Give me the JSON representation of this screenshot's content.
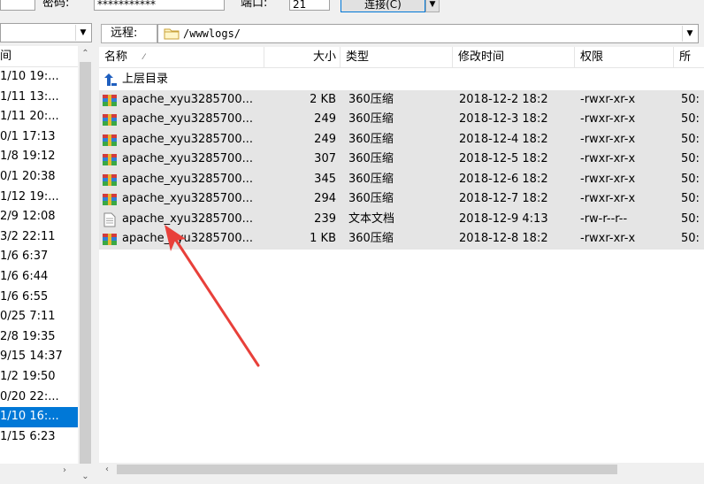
{
  "toolbar": {
    "password_label": "密码:",
    "password_value": "***********",
    "port_label": "端口:",
    "port_value": "21",
    "connect_button": "连接(C)"
  },
  "local": {
    "column_header": "间",
    "rows": [
      "1/10 19:...",
      "1/11 13:...",
      "1/11 20:...",
      "0/1 17:13",
      "1/8 19:12",
      "0/1 20:38",
      "1/12 19:...",
      "2/9 12:08",
      "3/2 22:11",
      "1/6 6:37",
      "1/6 6:44",
      "1/6 6:55",
      "0/25 7:11",
      "2/8 19:35",
      "9/15 14:37",
      "1/2 19:50",
      "0/20 22:...",
      "1/10 16:...",
      "1/15 6:23"
    ],
    "selected_index": 17
  },
  "remote": {
    "label": "远程:",
    "path": "/wwwlogs/",
    "columns": {
      "name": "名称",
      "size": "大小",
      "type": "类型",
      "modified": "修改时间",
      "permissions": "权限",
      "owner": "所"
    },
    "parent_dir": "上层目录",
    "files": [
      {
        "name": "apache_xyu3285700...",
        "size": "2 KB",
        "type": "360压缩",
        "modified": "2018-12-2 18:2",
        "permissions": "-rwxr-xr-x",
        "owner": "50:",
        "icon": "archive-icon"
      },
      {
        "name": "apache_xyu3285700...",
        "size": "249",
        "type": "360压缩",
        "modified": "2018-12-3 18:2",
        "permissions": "-rwxr-xr-x",
        "owner": "50:",
        "icon": "archive-icon"
      },
      {
        "name": "apache_xyu3285700...",
        "size": "249",
        "type": "360压缩",
        "modified": "2018-12-4 18:2",
        "permissions": "-rwxr-xr-x",
        "owner": "50:",
        "icon": "archive-icon"
      },
      {
        "name": "apache_xyu3285700...",
        "size": "307",
        "type": "360压缩",
        "modified": "2018-12-5 18:2",
        "permissions": "-rwxr-xr-x",
        "owner": "50:",
        "icon": "archive-icon"
      },
      {
        "name": "apache_xyu3285700...",
        "size": "345",
        "type": "360压缩",
        "modified": "2018-12-6 18:2",
        "permissions": "-rwxr-xr-x",
        "owner": "50:",
        "icon": "archive-icon"
      },
      {
        "name": "apache_xyu3285700...",
        "size": "294",
        "type": "360压缩",
        "modified": "2018-12-7 18:2",
        "permissions": "-rwxr-xr-x",
        "owner": "50:",
        "icon": "archive-icon"
      },
      {
        "name": "apache_xyu3285700...",
        "size": "239",
        "type": "文本文档",
        "modified": "2018-12-9 4:13",
        "permissions": "-rw-r--r--",
        "owner": "50:",
        "icon": "text-file-icon"
      },
      {
        "name": "apache_xyu3285700...",
        "size": "1 KB",
        "type": "360压缩",
        "modified": "2018-12-8 18:2",
        "permissions": "-rwxr-xr-x",
        "owner": "50:",
        "icon": "archive-icon"
      }
    ]
  },
  "colors": {
    "selection": "#0078d7",
    "row_bg": "#e5e5e5",
    "arrow": "#e8403a"
  }
}
